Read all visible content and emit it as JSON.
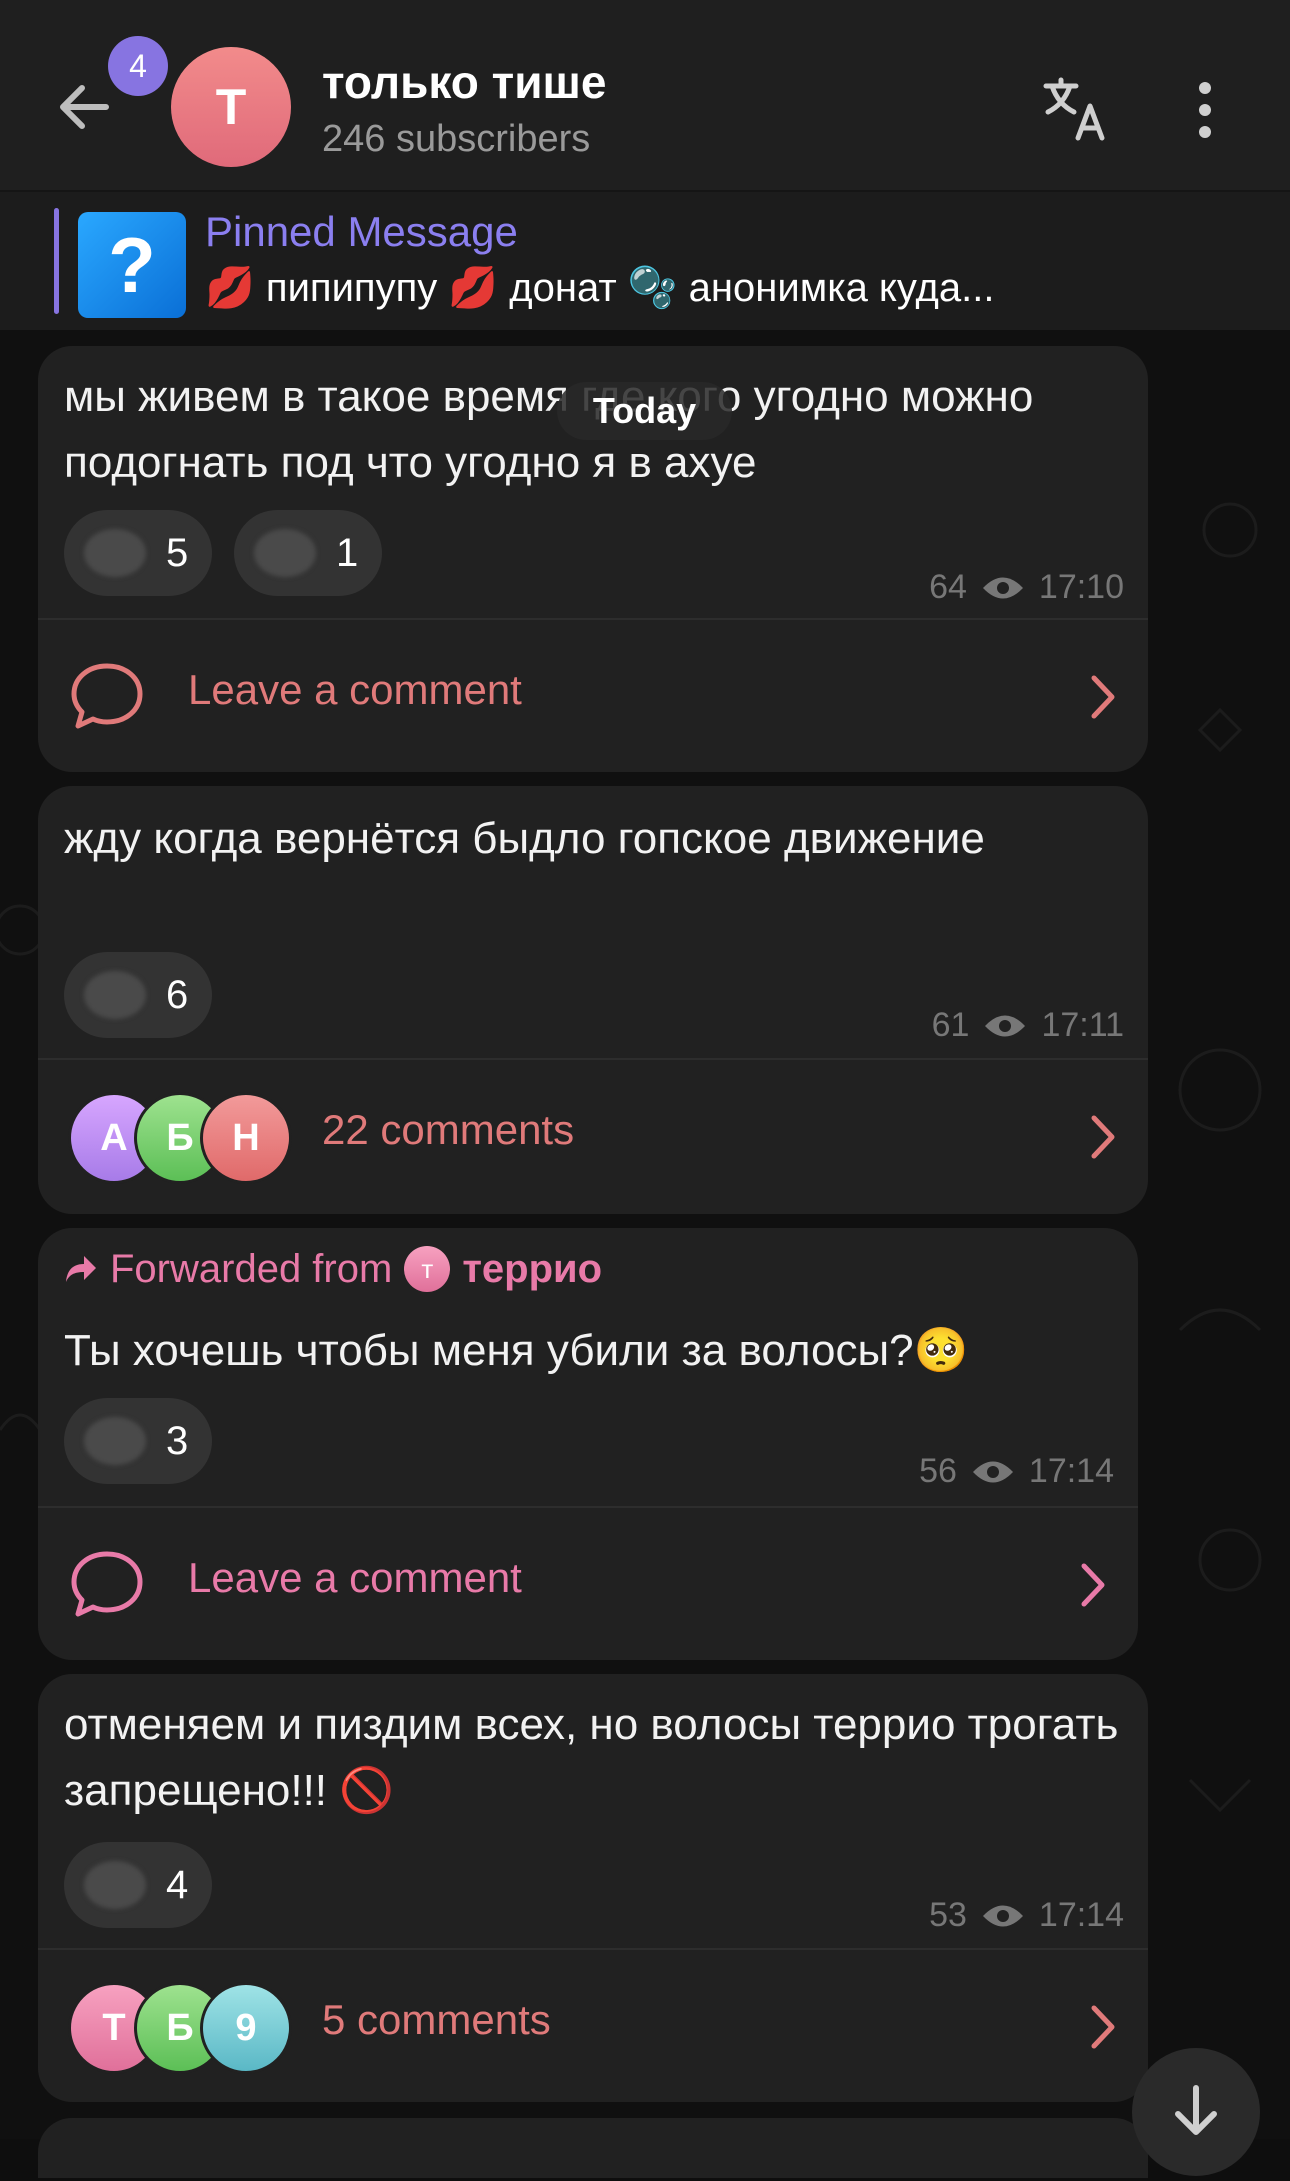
{
  "header": {
    "unread_badge": "4",
    "avatar_letter": "T",
    "title": "только тише",
    "subtitle": "246 subscribers"
  },
  "pinned": {
    "title": "Pinned Message",
    "text": "💋 пипипупу 💋   донат   🫧 анонимка куда..."
  },
  "date_chip": "Today",
  "messages": [
    {
      "text": "мы живем в такое время где кого угодно можно подогнать под что угодно я в ахуе",
      "reactions": [
        {
          "count": "5"
        },
        {
          "count": "1"
        }
      ],
      "views": "64",
      "time": "17:10",
      "comment_label": "Leave a comment"
    },
    {
      "text": "жду когда вернётся быдло гопское движение",
      "reactions": [
        {
          "count": "6"
        }
      ],
      "views": "61",
      "time": "17:11",
      "comment_label": "22 comments",
      "commenters": [
        "А",
        "Б",
        "Н"
      ]
    },
    {
      "forwarded_prefix": "Forwarded from",
      "forwarded_avatar": "т",
      "forwarded_name": "террио",
      "text": "Ты хочешь чтобы меня убили за волосы?🥺",
      "reactions": [
        {
          "count": "3"
        }
      ],
      "views": "56",
      "time": "17:14",
      "comment_label": "Leave a comment"
    },
    {
      "text": "отменяем и пиздим всех, но волосы террио трогать запрещено!!! 🚫",
      "reactions": [
        {
          "count": "4"
        }
      ],
      "views": "53",
      "time": "17:14",
      "comment_label": "5 comments",
      "commenters": [
        "Т",
        "Б",
        "9"
      ]
    }
  ],
  "colors": {
    "accent_purple": "#8774e1",
    "comment_red": "#e07a7a",
    "comment_pink": "#e87aa8"
  },
  "icons": [
    "back-arrow-icon",
    "translate-icon",
    "more-vertical-icon",
    "comment-bubble-icon",
    "chevron-right-icon",
    "eye-icon",
    "arrow-down-icon",
    "forward-arrow-icon"
  ]
}
